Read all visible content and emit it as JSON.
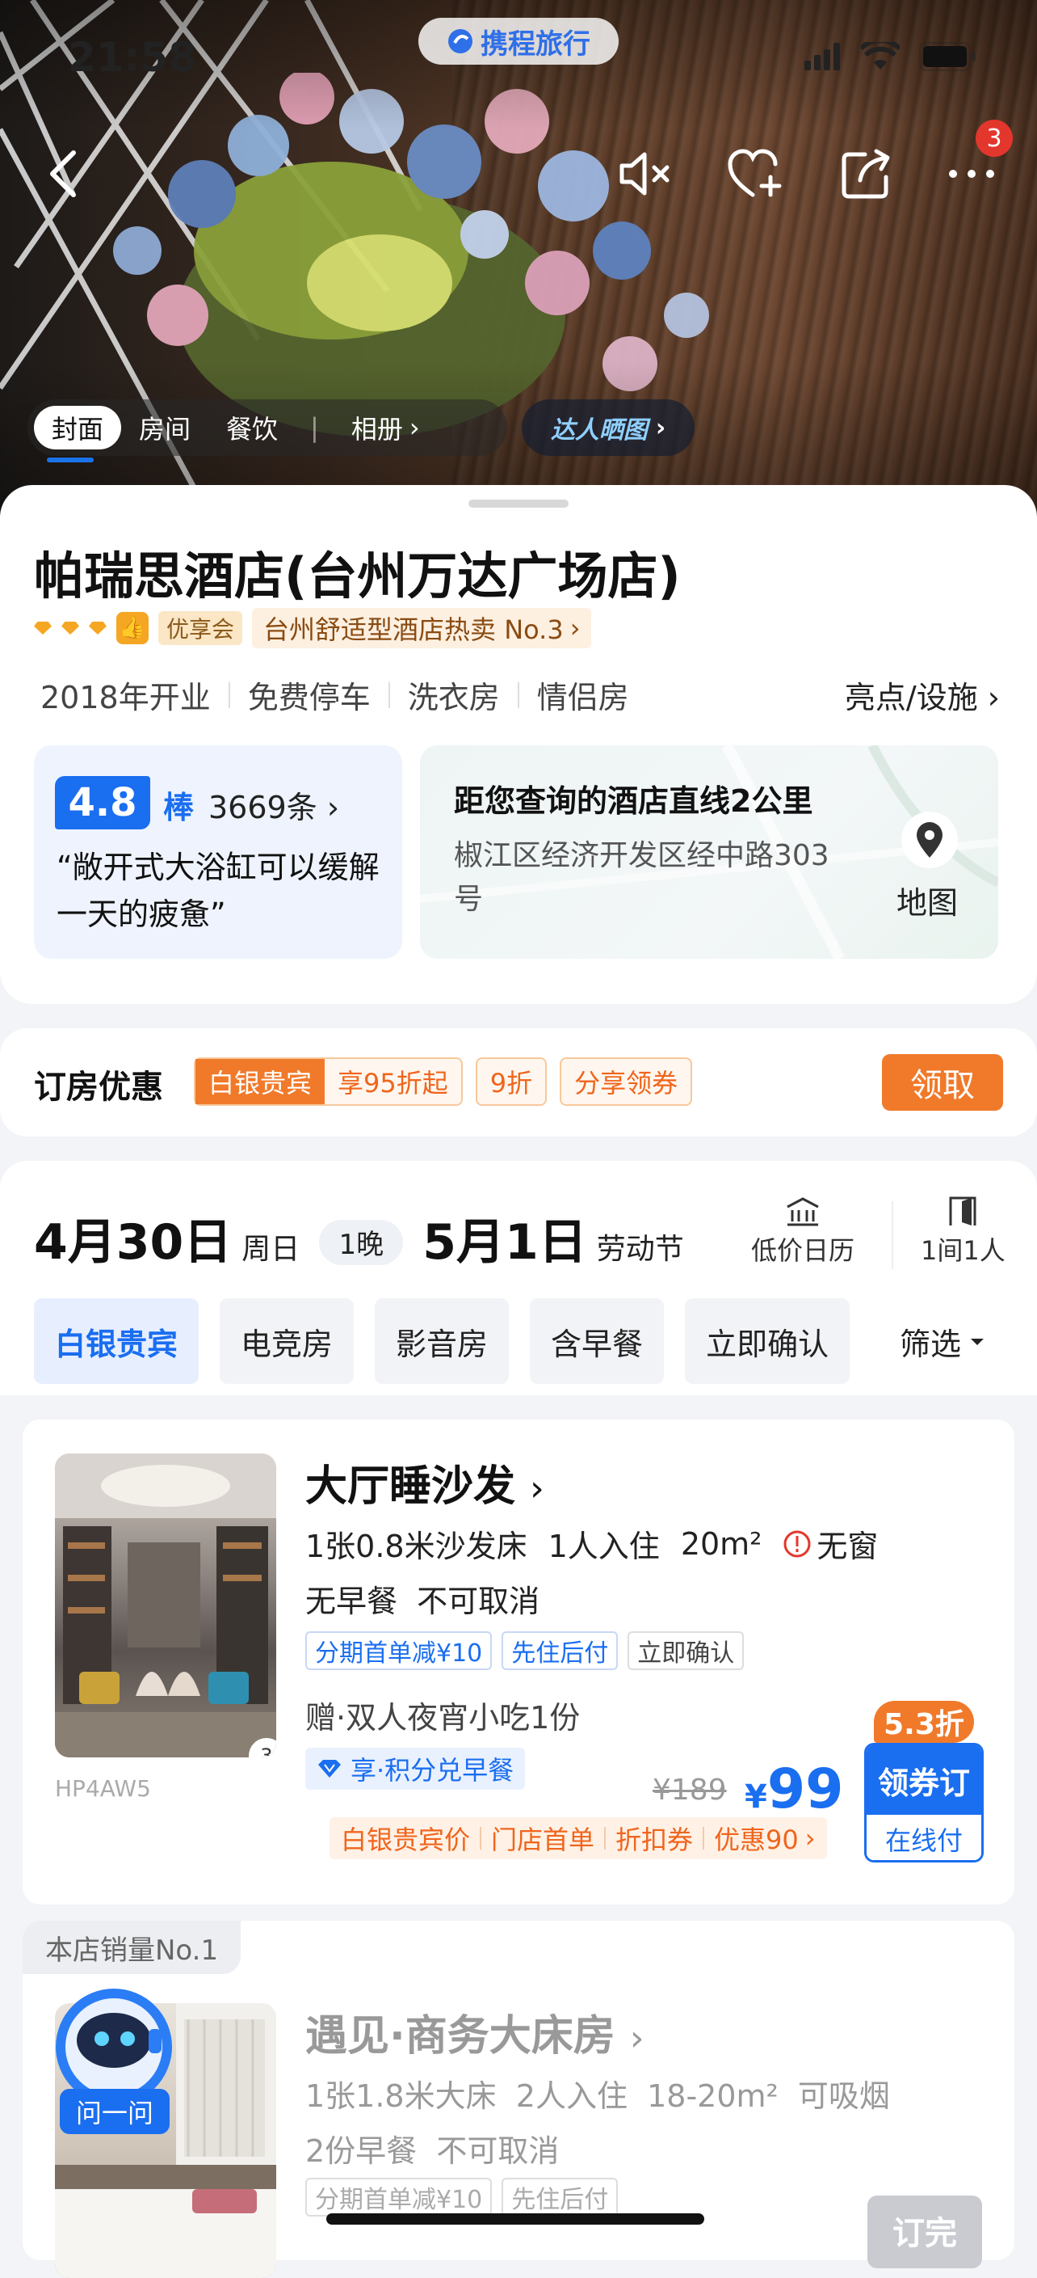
{
  "status_bar": {
    "time": "21:58"
  },
  "brand": {
    "name": "携程旅行"
  },
  "hero": {
    "notification_count": "3",
    "tabs": [
      "封面",
      "房间",
      "餐饮",
      "相册"
    ],
    "daren_label": "达人晒图"
  },
  "hotel": {
    "name": "帕瑞思酒店(台州万达广场店)",
    "member_badge": "优享会",
    "rank_text": "台州舒适型酒店热卖 No.3",
    "facilities": [
      "2018年开业",
      "免费停车",
      "洗衣房",
      "情侣房"
    ],
    "facilities_link": "亮点/设施"
  },
  "review": {
    "score": "4.8",
    "word": "棒",
    "count": "3669条",
    "quote": "“敞开式大浴缸可以缓解一天的疲惫”"
  },
  "location": {
    "distance_text": "距您查询的酒店直线2公里",
    "address": "椒江区经济开发区经中路303号",
    "map_label": "地图"
  },
  "promo": {
    "title": "订房优惠",
    "member_tier": "白银贵宾",
    "member_offer": "享95折起",
    "tag_discount": "9折",
    "tag_share": "分享领券",
    "claim_label": "领取"
  },
  "booking": {
    "checkin_date": "4月30日",
    "checkin_day": "周日",
    "nights": "1晚",
    "checkout_date": "5月1日",
    "checkout_day": "劳动节",
    "calendar_label": "低价日历",
    "rooms_label": "1间1人",
    "filters": [
      "白银贵宾",
      "电竞房",
      "影音房",
      "含早餐",
      "立即确认"
    ],
    "filter_button": "筛选"
  },
  "room1": {
    "name": "大厅睡沙发",
    "bed": "1张0.8米沙发床",
    "occupancy": "1人入住",
    "area": "20m²",
    "window": "无窗",
    "policy": "无早餐  不可取消",
    "tags": [
      "分期首单减¥10",
      "先住后付",
      "立即确认"
    ],
    "gift": "赠·双人夜宵小吃1份",
    "points": "享·积分兑早餐",
    "code": "HP4AW5",
    "image_count": "3",
    "price_old": "¥189",
    "price_currency": "¥",
    "price_new": "99",
    "discount_items": [
      "白银贵宾价",
      "门店首单",
      "折扣券",
      "优惠90"
    ],
    "zhe": "5.3折",
    "book_top": "领券订",
    "book_bottom": "在线付"
  },
  "room2": {
    "best_seller": "本店销量No.1",
    "name": "遇见·商务大床房",
    "spec": "1张1.8米大床  2人入住  18-20m²  可吸烟",
    "policy": "2份早餐  不可取消",
    "tags": [
      "分期首单减¥10",
      "先住后付"
    ],
    "book": "订完"
  },
  "assistant": {
    "label": "问一问"
  }
}
